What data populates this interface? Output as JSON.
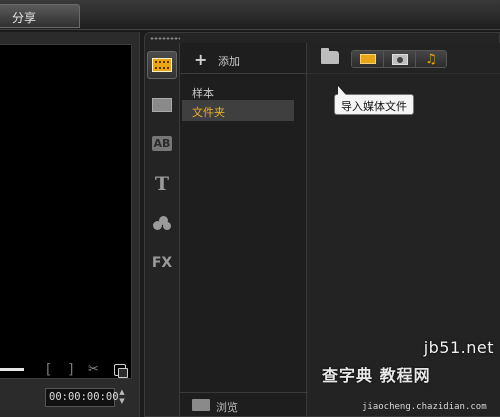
{
  "top_bar": {
    "share_tab": "分享"
  },
  "preview": {
    "mark_in": "[",
    "mark_out": "]",
    "timecode": "00:00:00:00",
    "stepper_up": "▲",
    "stepper_down": "▼",
    "cut_glyph": "✂"
  },
  "library": {
    "rail": [
      {
        "name": "media-icon",
        "active": true
      },
      {
        "name": "instant-project-icon",
        "active": false
      },
      {
        "name": "transition-icon",
        "glyph": "AB",
        "active": false
      },
      {
        "name": "title-icon",
        "glyph": "T",
        "active": false
      },
      {
        "name": "graphic-icon",
        "active": false
      },
      {
        "name": "filter-icon",
        "glyph": "FX",
        "active": false
      }
    ],
    "add_label": "添加",
    "add_glyph": "+",
    "folders": [
      {
        "label": "样本",
        "selected": false
      },
      {
        "label": "文件夹",
        "selected": true
      }
    ],
    "browse_label": "浏览",
    "collapse_glyph": "«",
    "toolbar": {
      "filters": [
        "video-filter-icon",
        "photo-filter-icon",
        "audio-filter-icon"
      ],
      "note_glyph": "♫"
    },
    "tooltip": "导入媒体文件"
  },
  "watermark": {
    "site": "jb51.net",
    "text": "查字典 教程网",
    "url": "jiaocheng.chazidian.com"
  },
  "colors": {
    "accent": "#e9a417",
    "selected_text": "#e8b028",
    "background": "#1b1b1b"
  }
}
